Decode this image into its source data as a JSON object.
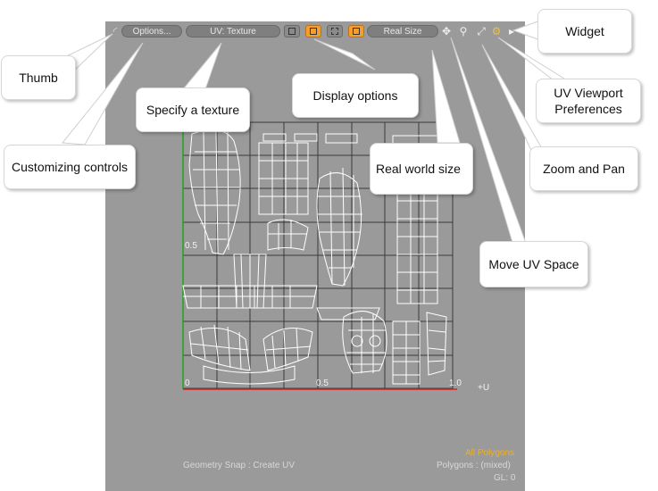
{
  "toolbar": {
    "options_label": "Options...",
    "texture_label": "UV: Texture",
    "realsize_label": "Real Size"
  },
  "callouts": {
    "thumb": "Thumb",
    "customizing": "Customizing controls",
    "texture": "Specify a texture",
    "display": "Display options",
    "realworld": "Real world size",
    "widget": "Widget",
    "prefs": "UV Viewport Preferences",
    "zoom": "Zoom and Pan",
    "move": "Move UV Space"
  },
  "axes": {
    "v_half": "0.5",
    "u_zero": "0",
    "u_half": "0.5",
    "u_one": "1.0",
    "u_label": "+U"
  },
  "status": {
    "all_polygons": "All Polygons",
    "polygons": "Polygons : (mixed)",
    "gl": "GL: 0",
    "snap": "Geometry Snap : Create UV"
  },
  "colors": {
    "viewport_bg": "#9a9a9a",
    "accent": "#f0a030",
    "u_axis": "#d62020",
    "v_axis": "#1fa31f",
    "uv_wire": "#ffffff"
  }
}
